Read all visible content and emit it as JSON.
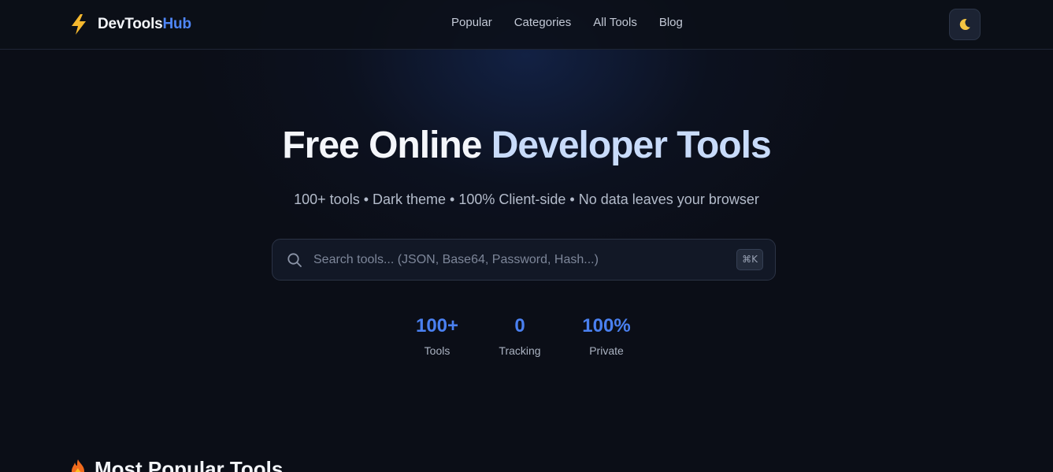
{
  "header": {
    "brand_name": "DevTools",
    "brand_accent": "Hub",
    "nav": [
      "Popular",
      "Categories",
      "All Tools",
      "Blog"
    ],
    "theme_toggle_icon": "moon-icon"
  },
  "hero": {
    "title_part1": "Free Online ",
    "title_part2": "Developer Tools",
    "subtitle": "100+ tools • Dark theme • 100% Client-side • No data leaves your browser"
  },
  "search": {
    "placeholder": "Search tools... (JSON, Base64, Password, Hash...)",
    "value": "",
    "shortcut": "⌘K"
  },
  "stats": [
    {
      "value": "100+",
      "label": "Tools"
    },
    {
      "value": "0",
      "label": "Tracking"
    },
    {
      "value": "100%",
      "label": "Private"
    }
  ],
  "section": {
    "title": "Most Popular Tools",
    "icon": "fire-icon"
  },
  "colors": {
    "background": "#0b0e17",
    "accent": "#4f86f7",
    "title_highlight": "#c8dbfa"
  }
}
